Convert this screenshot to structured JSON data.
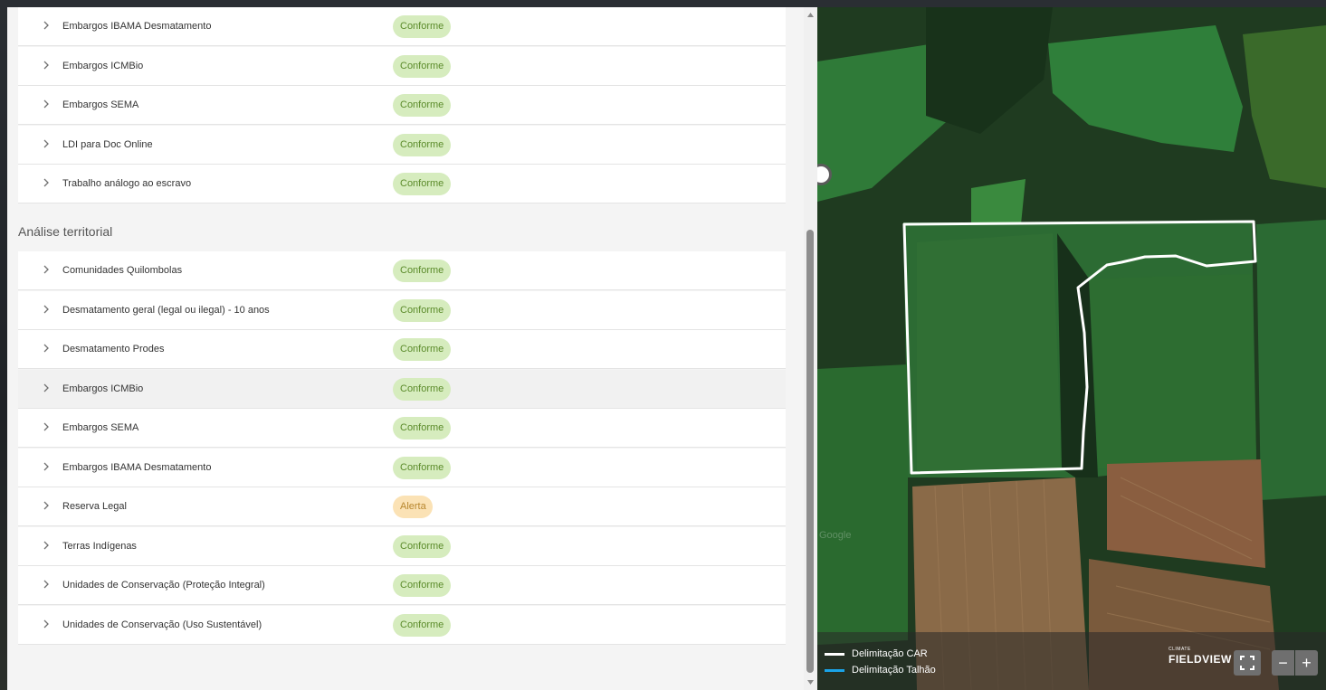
{
  "top_rows": [
    {
      "label": "Embargos IBAMA Desmatamento",
      "status": "Conforme"
    },
    {
      "label": "Embargos ICMBio",
      "status": "Conforme"
    },
    {
      "label": "Embargos SEMA",
      "status": "Conforme"
    },
    {
      "label": "LDI para Doc Online",
      "status": "Conforme"
    },
    {
      "label": "Trabalho análogo ao escravo",
      "status": "Conforme"
    }
  ],
  "section": {
    "title": "Análise territorial"
  },
  "territorial_rows": [
    {
      "label": "Comunidades Quilombolas",
      "status": "Conforme"
    },
    {
      "label": "Desmatamento geral (legal ou ilegal) - 10 anos",
      "status": "Conforme"
    },
    {
      "label": "Desmatamento Prodes",
      "status": "Conforme"
    },
    {
      "label": "Embargos ICMBio",
      "status": "Conforme"
    },
    {
      "label": "Embargos SEMA",
      "status": "Conforme"
    },
    {
      "label": "Embargos IBAMA Desmatamento",
      "status": "Conforme"
    },
    {
      "label": "Reserva Legal",
      "status": "Alerta"
    },
    {
      "label": "Terras Indígenas",
      "status": "Conforme"
    },
    {
      "label": "Unidades de Conservação (Proteção Integral)",
      "status": "Conforme"
    },
    {
      "label": "Unidades de Conservação (Uso Sustentável)",
      "status": "Conforme"
    }
  ],
  "map": {
    "legend": [
      {
        "label": "Delimitação CAR",
        "color": "#ffffff"
      },
      {
        "label": "Delimitação Talhão",
        "color": "#1aa3e8"
      }
    ],
    "logo_small": "CLIMATE",
    "logo": "FIELDVIEW",
    "watermark": "Google",
    "zoom_out": "−",
    "zoom_in": "+"
  },
  "colors": {
    "conforme_bg": "#d6ecbe",
    "conforme_text": "#5b8b2a",
    "alerta_bg": "#fbe2b5",
    "alerta_text": "#b8872f"
  },
  "icons": {
    "row_expand": "chevron-right-icon",
    "scroll_up": "triangle-up-icon",
    "scroll_down": "triangle-down-icon",
    "fullscreen": "fullscreen-icon"
  }
}
